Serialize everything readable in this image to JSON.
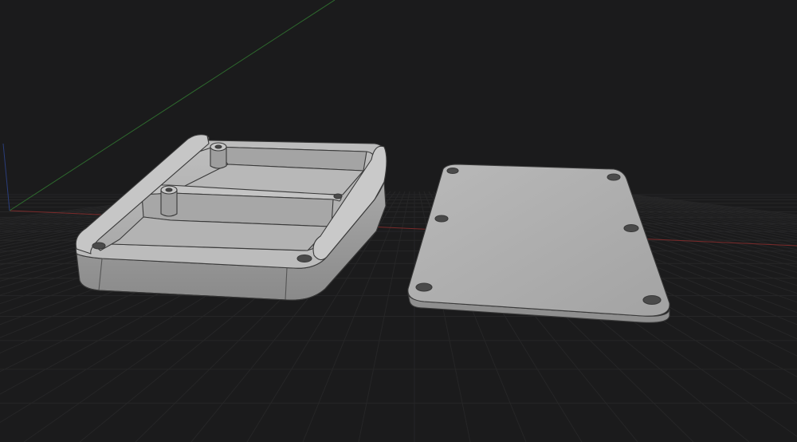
{
  "scene": {
    "background_color": "#1b1b1c",
    "grid_color": "#262627",
    "model_fill": "#b3b3b3",
    "model_shadow": "#8e8e8e",
    "model_edge": "#3a3a3a",
    "axes": {
      "x_axis_color": "#7a2a2a",
      "y_axis_color": "#2e6b2e",
      "z_axis_color": "#2a3d7a"
    },
    "objects": [
      {
        "name": "enclosure-base",
        "kind": "box-with-divider",
        "holes": 4,
        "standoffs": 2
      },
      {
        "name": "enclosure-lid",
        "kind": "flat-plate",
        "holes": 6
      }
    ]
  }
}
